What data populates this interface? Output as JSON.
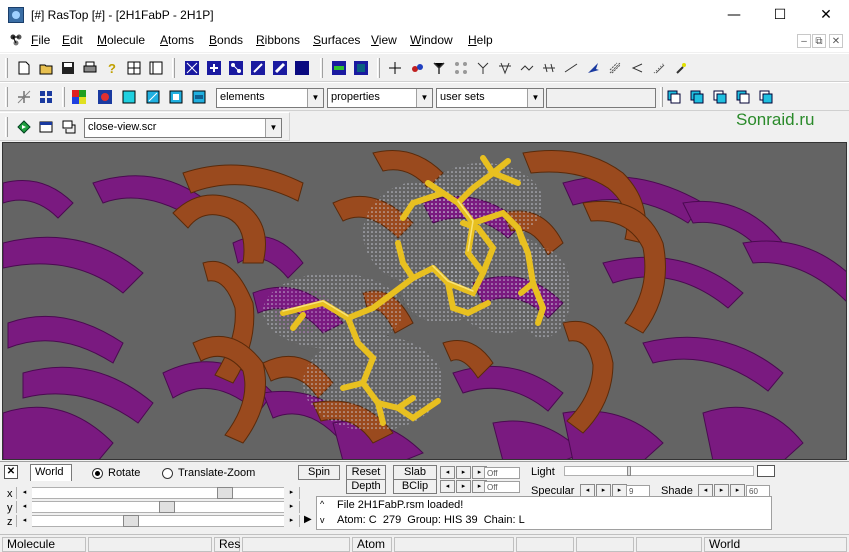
{
  "window": {
    "title": "[#] RasTop [#] - [2H1FabP - 2H1P]",
    "minimize_glyph": "—",
    "maximize_glyph": "☐",
    "close_glyph": "✕"
  },
  "menu": {
    "items": [
      {
        "label": "File",
        "u": "F",
        "rest": "ile"
      },
      {
        "label": "Edit",
        "u": "E",
        "rest": "dit"
      },
      {
        "label": "Molecule",
        "u": "M",
        "rest": "olecule"
      },
      {
        "label": "Atoms",
        "u": "A",
        "rest": "toms"
      },
      {
        "label": "Bonds",
        "u": "B",
        "rest": "onds"
      },
      {
        "label": "Ribbons",
        "u": "R",
        "rest": "ibbons"
      },
      {
        "label": "Surfaces",
        "u": "S",
        "rest": "urfaces"
      },
      {
        "label": "View",
        "u": "V",
        "rest": "iew"
      },
      {
        "label": "Window",
        "u": "W",
        "rest": "indow"
      },
      {
        "label": "Help",
        "u": "H",
        "rest": "elp"
      }
    ],
    "mdi_minimize": "–",
    "mdi_restore": "⧉",
    "mdi_close": "✕"
  },
  "watermark": "Sonraid.ru",
  "toolbar2": {
    "combo_elements": "elements",
    "combo_properties": "properties",
    "combo_usersets": "user sets",
    "combo_empty": ""
  },
  "toolbar3": {
    "script_combo": "close-view.scr"
  },
  "bottom": {
    "close_glyph": "✕",
    "world_tab": "World",
    "rotate_label": "Rotate",
    "translate_zoom_label": "Translate-Zoom",
    "axis_x": "x",
    "axis_y": "y",
    "axis_z": "z",
    "spin": "Spin",
    "reset": "Reset",
    "depth": "Depth",
    "slab": "Slab",
    "bclip": "BClip",
    "off1": "Off",
    "off2": "Off",
    "light": "Light",
    "specular": "Specular",
    "specular_value": "9",
    "shade": "Shade",
    "shade_value": "60",
    "msg_line1": "File 2H1FabP.rsm loaded!",
    "msg_line2": "Atom: C  279  Group: HIS 39  Chain: L"
  },
  "statusbar": {
    "molecule": "Molecule",
    "res": "Res",
    "atom": "Atom",
    "world": "World"
  },
  "colors": {
    "viewport_bg": "#646464",
    "ribbon_purple": "#7a1a80",
    "ribbon_brown": "#9a4a1e",
    "ligand_yellow": "#e8c020",
    "surface_dots": "#c8c8d8",
    "watermark_green": "#2a8a2a"
  },
  "icons": {
    "new": "new-file-icon",
    "open": "open-folder-icon",
    "save": "save-icon",
    "print": "print-icon"
  }
}
